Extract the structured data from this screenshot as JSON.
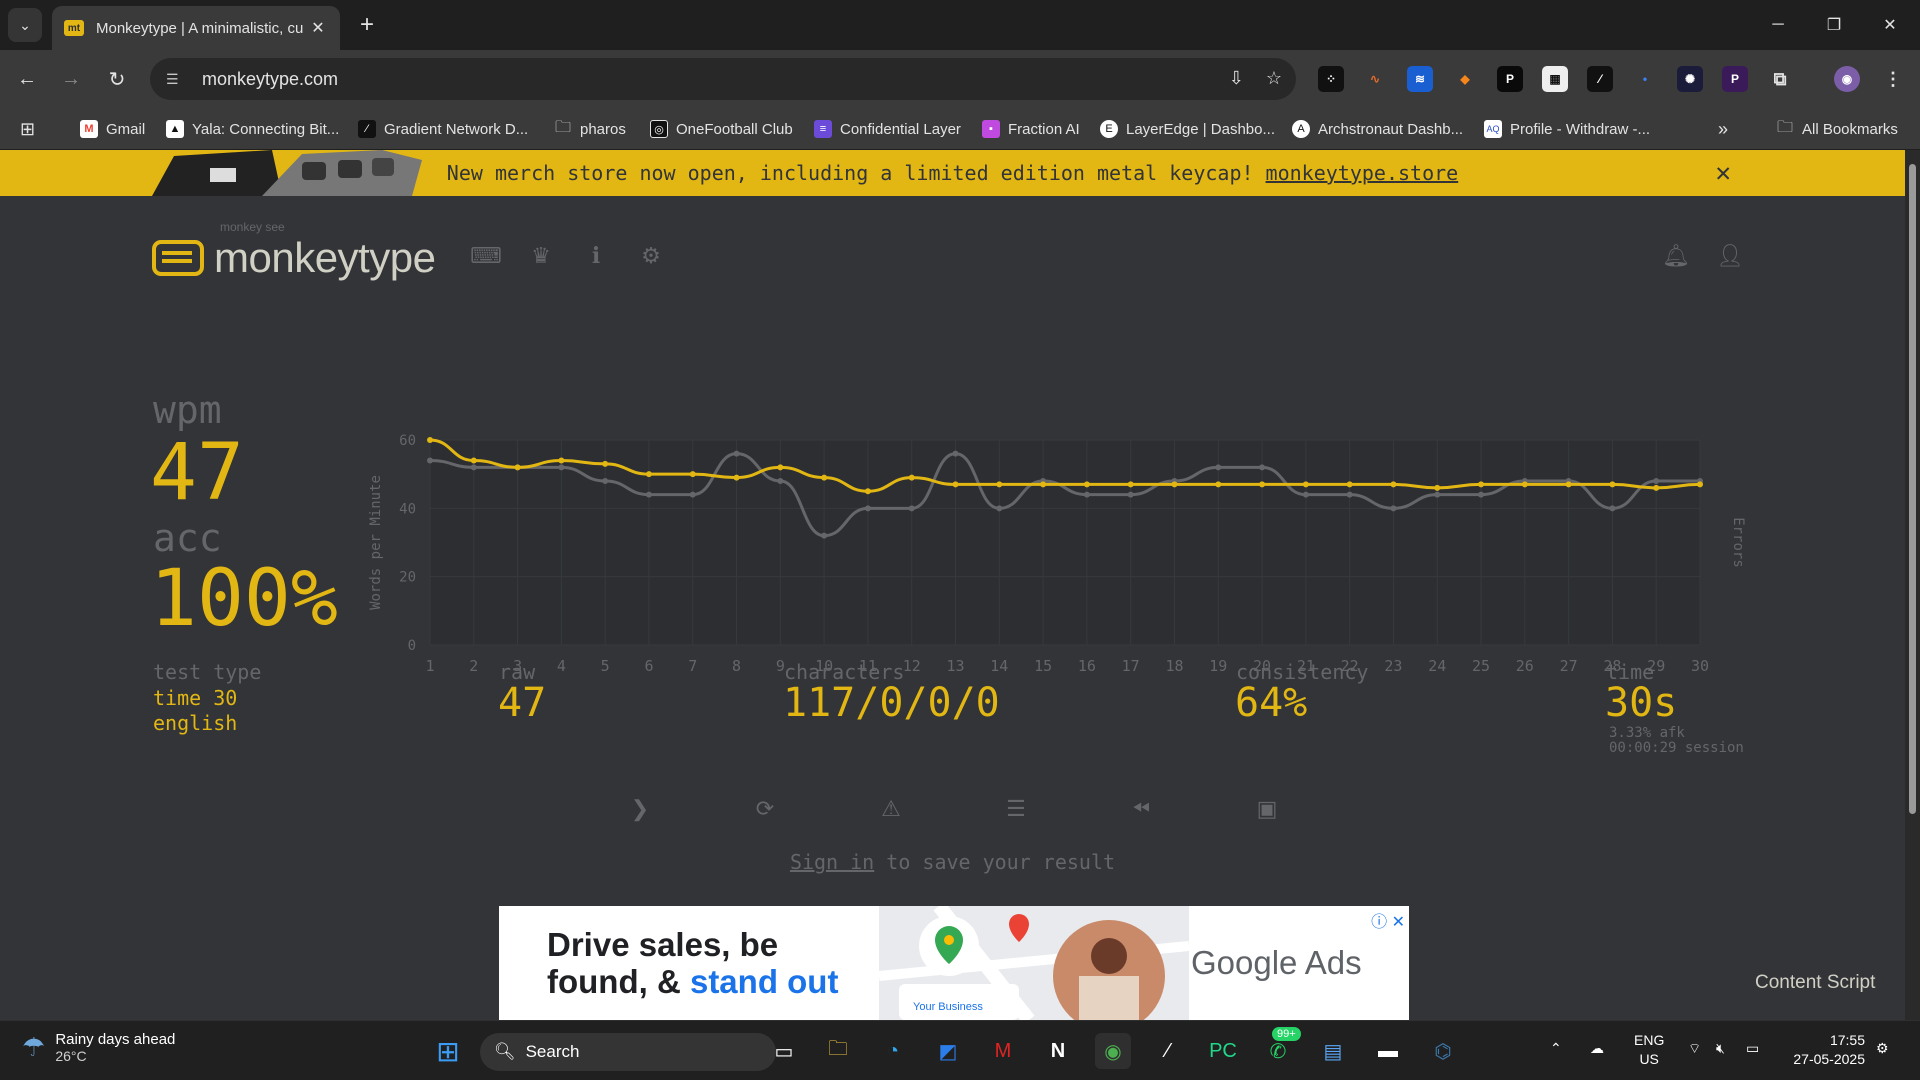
{
  "browser": {
    "tab_title": "Monkeytype | A minimalistic, cu",
    "tab_favicon": "mt",
    "url": "monkeytype.com",
    "bookmarks": [
      {
        "label": "Gmail",
        "icon": "gmail-icon",
        "color": "#ea4335"
      },
      {
        "label": "Yala: Connecting Bit...",
        "icon": "yala-icon",
        "color": "#111111"
      },
      {
        "label": "Gradient Network D...",
        "icon": "gradient-icon",
        "color": "#111111"
      },
      {
        "label": "pharos",
        "icon": "folder-icon",
        "color": "#3a3a3a"
      },
      {
        "label": "OneFootball Club",
        "icon": "onefootball-icon",
        "color": "#111111"
      },
      {
        "label": "Confidential Layer",
        "icon": "confidential-icon",
        "color": "#6b4bd8"
      },
      {
        "label": "Fraction AI",
        "icon": "fraction-icon",
        "color": "#c04ae0"
      },
      {
        "label": "LayerEdge | Dashbo...",
        "icon": "layeredge-icon",
        "color": "#111111"
      },
      {
        "label": "Archstronaut Dashb...",
        "icon": "archstronaut-icon",
        "color": "#111111"
      },
      {
        "label": "Profile - Withdraw -...",
        "icon": "profile-icon",
        "color": "#2b4cc8"
      }
    ],
    "all_bookmarks": "All Bookmarks"
  },
  "banner": {
    "text": "New merch store now open, including a limited edition metal keycap!",
    "link": "monkeytype.store"
  },
  "logo": {
    "sub": "monkey see",
    "main": "monkeytype"
  },
  "result": {
    "wpm_label": "wpm",
    "wpm": "47",
    "acc_label": "acc",
    "acc": "100%",
    "test_type_label": "test type",
    "test_type_1": "time 30",
    "test_type_2": "english",
    "raw_label": "raw",
    "raw": "47",
    "characters_label": "characters",
    "characters": "117/0/0/0",
    "consistency_label": "consistency",
    "consistency": "64%",
    "time_label": "time",
    "time": "30s",
    "afk": "3.33% afk",
    "session": "00:00:29 session"
  },
  "chart_data": {
    "type": "line",
    "ylabel": "Words per Minute",
    "y2label": "Errors",
    "ylim": [
      0,
      60
    ],
    "yticks": [
      0,
      20,
      40,
      60
    ],
    "x": [
      1,
      2,
      3,
      4,
      5,
      6,
      7,
      8,
      9,
      10,
      11,
      12,
      13,
      14,
      15,
      16,
      17,
      18,
      19,
      20,
      21,
      22,
      23,
      24,
      25,
      26,
      27,
      28,
      29,
      30
    ],
    "series": [
      {
        "key": "wpm",
        "color": "#e2b714",
        "values": [
          60,
          54,
          52,
          54,
          53,
          50,
          50,
          49,
          52,
          49,
          45,
          49,
          47,
          47,
          47,
          47,
          47,
          47,
          47,
          47,
          47,
          47,
          47,
          46,
          47,
          47,
          47,
          47,
          46,
          47
        ]
      },
      {
        "key": "raw",
        "color": "#646669",
        "values": [
          54,
          52,
          52,
          52,
          48,
          44,
          44,
          56,
          48,
          32,
          40,
          40,
          56,
          40,
          48,
          44,
          44,
          48,
          52,
          52,
          44,
          44,
          40,
          44,
          44,
          48,
          48,
          40,
          48,
          48
        ]
      }
    ]
  },
  "signin": {
    "link": "Sign in",
    "rest": " to save your result"
  },
  "ad": {
    "line1": "Drive sales, be",
    "line2a": "found, & ",
    "line2b": "stand out",
    "brand": "Google Ads",
    "badge": "Your Business"
  },
  "content_script": "Content Script",
  "taskbar": {
    "weather_title": "Rainy days ahead",
    "weather_temp": "26°C",
    "search": "Search",
    "whatsapp_badge": "99+",
    "lang1": "ENG",
    "lang2": "US",
    "time": "17:55",
    "date": "27-05-2025"
  }
}
